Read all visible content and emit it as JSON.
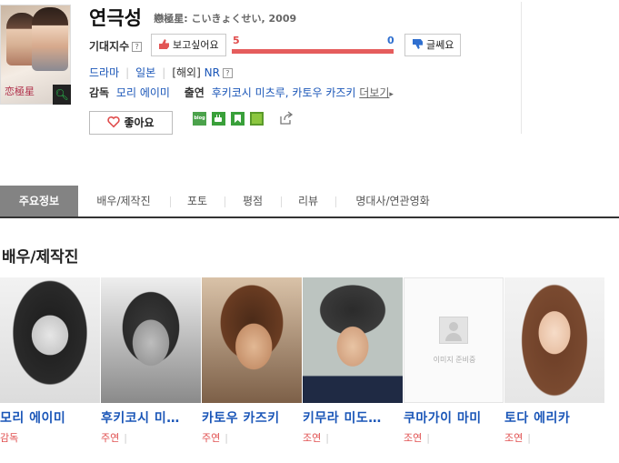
{
  "movie": {
    "title": "연극성",
    "original_title": "戀極星: こいきょくせい",
    "year": "2009",
    "poster_text": "恋極星"
  },
  "rating": {
    "label": "기대지수",
    "help": "?",
    "want_label": "보고싶어요",
    "dont_label": "글쎄요",
    "want_count": "5",
    "dont_count": "0",
    "want_ratio": 1.0
  },
  "meta": {
    "genre": "드라마",
    "country": "일본",
    "release": "[해외]",
    "grade": "NR",
    "grade_help": "?",
    "director_label": "감독",
    "director": "모리 에이미",
    "cast_label": "출연",
    "cast": "후키코시 미츠루, 카토우 카즈키",
    "more": "더보기"
  },
  "actions": {
    "like_label": "좋아요",
    "share_blog": "blog"
  },
  "tabs": [
    "주요정보",
    "배우/제작진",
    "포토",
    "평점",
    "리뷰",
    "명대사/연관영화"
  ],
  "section_title": "배우/제작진",
  "cast_cards": [
    {
      "name": "모리 에이미",
      "role": "감독",
      "sep": "",
      "photo": "photo"
    },
    {
      "name": "후키코시 미…",
      "role": "주연",
      "sep": "|",
      "photo": "photo"
    },
    {
      "name": "카토우 카즈키",
      "role": "주연",
      "sep": "|",
      "photo": "photo"
    },
    {
      "name": "키무라 미도…",
      "role": "조연",
      "sep": "|",
      "photo": "photo"
    },
    {
      "name": "쿠마가이 마미",
      "role": "조연",
      "sep": "|",
      "photo": "placeholder",
      "placeholder_text": "이미지 준비중"
    },
    {
      "name": "토다 에리카",
      "role": "조연",
      "sep": "|",
      "photo": "photo"
    }
  ],
  "colors": {
    "accent_red": "#e55d5d",
    "link_blue": "#1a56b8",
    "tab_active": "#838383"
  }
}
